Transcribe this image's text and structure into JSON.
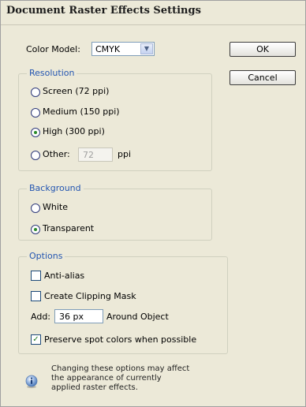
{
  "dialog": {
    "title": "Document Raster Effects Settings"
  },
  "color_model": {
    "label": "Color Model:",
    "value": "CMYK"
  },
  "buttons": {
    "ok": "OK",
    "cancel": "Cancel"
  },
  "resolution": {
    "legend": "Resolution",
    "options": [
      "Screen (72 ppi)",
      "Medium (150 ppi)",
      "High (300 ppi)",
      "Other:"
    ],
    "selected": "High (300 ppi)",
    "other_value": "72",
    "other_unit": "ppi"
  },
  "background": {
    "legend": "Background",
    "options": [
      "White",
      "Transparent"
    ],
    "selected": "Transparent"
  },
  "options": {
    "legend": "Options",
    "anti_alias": {
      "label": "Anti-alias",
      "checked": false
    },
    "clipping_mask": {
      "label": "Create Clipping Mask",
      "checked": false
    },
    "add_label": "Add:",
    "add_value": "36 px",
    "add_suffix": "Around Object",
    "preserve_spot": {
      "label": "Preserve spot colors when possible",
      "checked": true
    }
  },
  "info": {
    "icon": "info-icon",
    "lines": [
      "Changing these options may affect",
      "the appearance of currently",
      "applied raster effects."
    ]
  }
}
